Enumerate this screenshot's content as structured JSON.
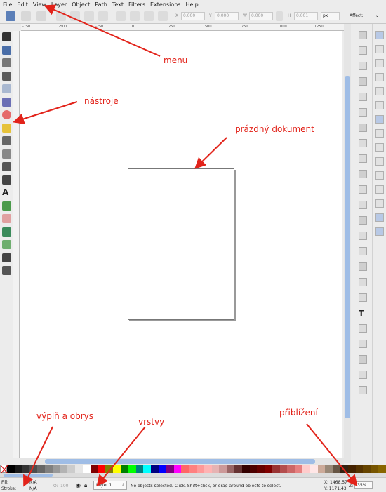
{
  "menu": [
    "File",
    "Edit",
    "View",
    "Layer",
    "Object",
    "Path",
    "Text",
    "Filters",
    "Extensions",
    "Help"
  ],
  "controls": {
    "x_label": "X",
    "x_value": "0.000",
    "y_label": "Y",
    "y_value": "0.000",
    "w_label": "W",
    "w_value": "0.000",
    "h_label": "H",
    "h_value": "0.001",
    "unit": "px",
    "affect_label": "Affect:"
  },
  "ruler": {
    "ticks": [
      "-750",
      "-500",
      "-250",
      "0",
      "250",
      "500",
      "750",
      "1000",
      "1250"
    ]
  },
  "tools": [
    "selector-icon",
    "node-icon",
    "tweak-icon",
    "zoom-icon",
    "rect-icon",
    "box3d-icon",
    "circle-icon",
    "star-icon",
    "spiral-icon",
    "pencil-icon",
    "pen-icon",
    "calligraphy-icon",
    "text-icon",
    "spray-icon",
    "eraser-icon",
    "bucket-icon",
    "gradient-icon",
    "dropper-icon",
    "connector-icon"
  ],
  "palette": [
    "#000000",
    "#1a1a1a",
    "#333333",
    "#4d4d4d",
    "#666666",
    "#808080",
    "#999999",
    "#b3b3b3",
    "#cccccc",
    "#e6e6e6",
    "#ffffff",
    "#800000",
    "#ff0000",
    "#808000",
    "#ffff00",
    "#008000",
    "#00ff00",
    "#008080",
    "#00ffff",
    "#000080",
    "#0000ff",
    "#800080",
    "#ff00ff",
    "#ff6666",
    "#ff8080",
    "#ff9999",
    "#ffb3b3",
    "#e6b3b3",
    "#cc9999",
    "#996666",
    "#663333",
    "#330000",
    "#4d0000",
    "#660000",
    "#800000",
    "#993333",
    "#b34d4d",
    "#cc6666",
    "#e68080",
    "#ffcccc",
    "#ffe6e6",
    "#ccaa99",
    "#998877",
    "#665544",
    "#332211",
    "#442200",
    "#553300",
    "#664400",
    "#775500",
    "#886600"
  ],
  "status": {
    "fill_label": "Fill:",
    "fill_value": "N/A",
    "stroke_label": "Stroke:",
    "stroke_value": "N/A",
    "opacity_label": "O:",
    "opacity_value": "100",
    "layer": "Layer 1",
    "message": "No objects selected. Click, Shift+click, or drag around objects to select.",
    "x_coord": "X: 1468.57",
    "y_coord": "Y: 1171.43",
    "zoom_label": "Z:",
    "zoom_value": "35%"
  },
  "annotations": {
    "menu": "menu",
    "tools": "nástroje",
    "document": "prázdný dokument",
    "fill_stroke": "výplň a obrys",
    "layers": "vrstvy",
    "zoom": "přiblížení"
  },
  "colors": {
    "annotation": "#e2231a",
    "scroll_thumb": "#9fbde6"
  }
}
